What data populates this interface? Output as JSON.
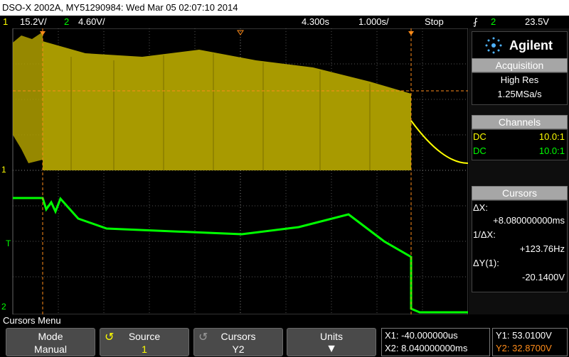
{
  "title_bar": {
    "text": "DSO-X 2002A, MY51290984: Wed Mar 05 02:07:10 2014"
  },
  "status": {
    "ch1_label": "1",
    "ch1_scale": "15.2V/",
    "ch2_label": "2",
    "ch2_scale": "4.60V/",
    "time_delay": "4.300s",
    "time_scale": "1.000s/",
    "run_state": "Stop",
    "trigger_source": "2",
    "trigger_level": "23.5V"
  },
  "brand": {
    "name": "Agilent"
  },
  "acquisition": {
    "title": "Acquisition",
    "mode": "High Res",
    "rate": "1.25MSa/s"
  },
  "channels": {
    "title": "Channels",
    "rows": [
      {
        "coupling": "DC",
        "probe": "10.0:1"
      },
      {
        "coupling": "DC",
        "probe": "10.0:1"
      }
    ]
  },
  "cursors": {
    "title": "Cursors",
    "dx_label": "ΔX:",
    "dx_value": "+8.080000000ms",
    "inv_dx_label": "1/ΔX:",
    "inv_dx_value": "+123.76Hz",
    "dy_label": "ΔY(1):",
    "dy_value": "-20.1400V"
  },
  "plot_markers": {
    "ch1": "1",
    "ch2": "2",
    "trigger": "T"
  },
  "menu": {
    "title": "Cursors Menu"
  },
  "softkeys": [
    {
      "label": "Mode",
      "value": "Manual"
    },
    {
      "label": "Source",
      "value": "1"
    },
    {
      "label": "Cursors",
      "value": "Y2"
    },
    {
      "label": "Units",
      "value": ""
    }
  ],
  "readouts": {
    "x1": "X1: -40.000000us",
    "x2": "X2: 8.040000000ms",
    "y1": "Y1: 53.0100V",
    "y2": "Y2: 32.8700V"
  },
  "colors": {
    "ch1": "#ffff00",
    "ch2": "#00ff00",
    "cursor": "#ff8c1a"
  }
}
